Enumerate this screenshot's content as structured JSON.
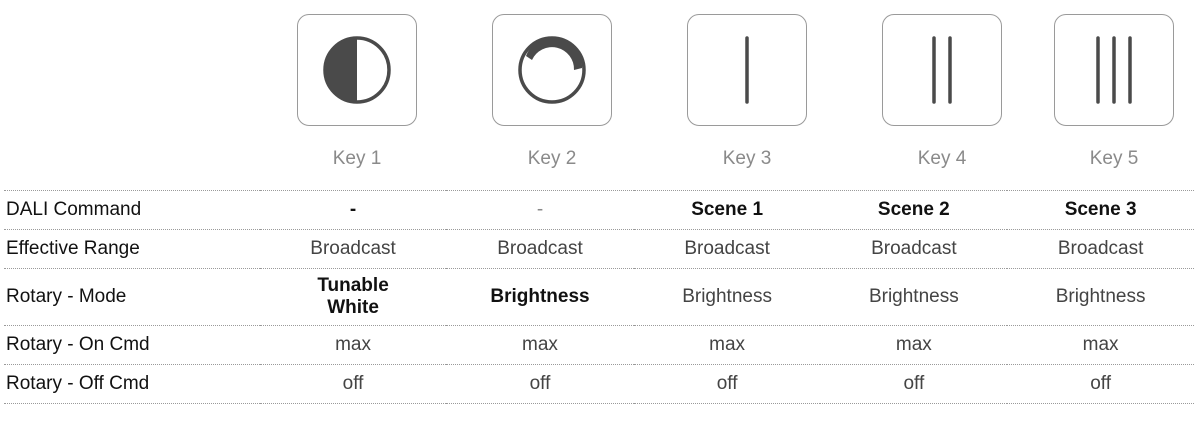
{
  "keys": [
    {
      "label": "Key 1",
      "icon": "half-circle-icon"
    },
    {
      "label": "Key 2",
      "icon": "brightness-dial-icon"
    },
    {
      "label": "Key 3",
      "icon": "one-bar-icon"
    },
    {
      "label": "Key 4",
      "icon": "two-bars-icon"
    },
    {
      "label": "Key 5",
      "icon": "three-bars-icon"
    }
  ],
  "table": {
    "rows": [
      {
        "label": "DALI Command",
        "cells": [
          "-",
          "-",
          "Scene 1",
          "Scene 2",
          "Scene 3"
        ]
      },
      {
        "label": "Effective Range",
        "cells": [
          "Broadcast",
          "Broadcast",
          "Broadcast",
          "Broadcast",
          "Broadcast"
        ]
      },
      {
        "label": "Rotary - Mode",
        "cells": [
          "Tunable\nWhite",
          "Brightness",
          "Brightness",
          "Brightness",
          "Brightness"
        ]
      },
      {
        "label": "Rotary - On Cmd",
        "cells": [
          "max",
          "max",
          "max",
          "max",
          "max"
        ]
      },
      {
        "label": "Rotary - Off Cmd",
        "cells": [
          "off",
          "off",
          "off",
          "off",
          "off"
        ]
      }
    ]
  },
  "colors": {
    "icon": "#4a4a4a",
    "tile_border": "#9a9a9a",
    "key_label": "#8a8a8a"
  }
}
